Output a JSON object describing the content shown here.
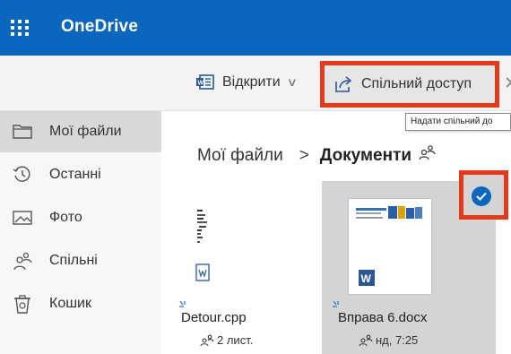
{
  "app": {
    "title": "OneDrive"
  },
  "commandbar": {
    "open_label": "Відкрити",
    "share_label": "Спільний доступ",
    "share_tooltip": "Надати спільний до"
  },
  "sidebar": {
    "items": [
      {
        "label": "Мої файли",
        "icon": "folder-icon",
        "active": true
      },
      {
        "label": "Останні",
        "icon": "recent-icon"
      },
      {
        "label": "Фото",
        "icon": "photo-icon"
      },
      {
        "label": "Спільні",
        "icon": "shared-icon"
      },
      {
        "label": "Кошик",
        "icon": "recycle-bin-icon"
      }
    ]
  },
  "breadcrumb": {
    "root": "Мої файли",
    "separator": ">",
    "current": "Документи"
  },
  "files": [
    {
      "name": "Detour.cpp",
      "meta": "2 лист.",
      "icon": "text-file-icon",
      "selected": false
    },
    {
      "name": "Вправа 6.docx",
      "meta": "нд, 7:25",
      "icon": "word-file-icon",
      "selected": true
    }
  ],
  "colors": {
    "brand": "#0a67bd",
    "highlight_box": "#e5391b",
    "selected_tile": "#d4d4d4",
    "new_marker": "#2b7bd1"
  }
}
